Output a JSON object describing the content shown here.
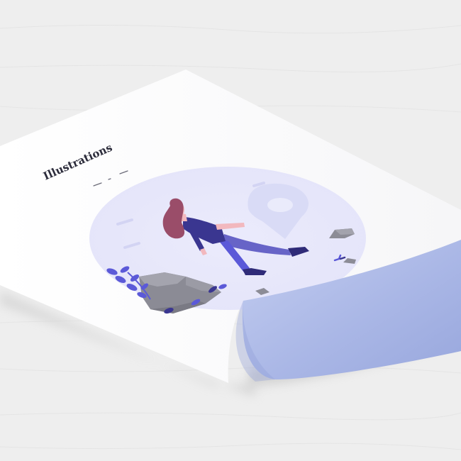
{
  "poster": {
    "title": "Illustrations"
  },
  "colors": {
    "background": "#eeeeee",
    "paper": "#ffffff",
    "paper_curl": "#aebbe8",
    "circle": "#e8e8fb",
    "pin": "#dadcf6",
    "accent": "#5b59d8",
    "navy": "#3a3690",
    "hair": "#9a4d69",
    "skin": "#f2b8be",
    "rock": "#8c8c96"
  },
  "icons": {
    "location_pin": "location-pin-icon",
    "plant": "leaf-icon"
  }
}
